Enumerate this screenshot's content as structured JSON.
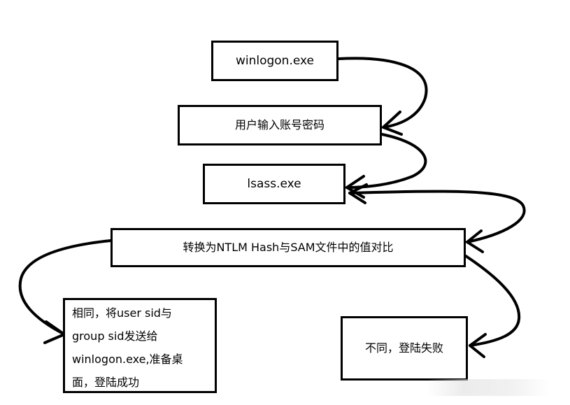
{
  "nodes": {
    "winlogon": "winlogon.exe",
    "user_input": "用户输入账号密码",
    "lsass": "lsass.exe",
    "compare": "转换为NTLM Hash与SAM文件中的值对比",
    "success_lines": [
      "相同，将user sid与",
      "group sid发送给",
      "winlogon.exe,准备桌",
      "面，登陆成功"
    ],
    "fail": "不同，登陆失败"
  },
  "colors": {
    "stroke": "#000000",
    "background": "#ffffff"
  }
}
